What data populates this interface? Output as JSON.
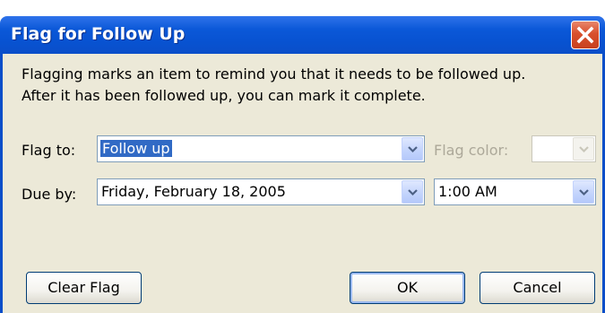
{
  "window": {
    "title": "Flag for Follow Up"
  },
  "description": {
    "line1": "Flagging marks an item to remind you that it needs to be followed up.",
    "line2": "After it has been followed up, you can mark it complete."
  },
  "flag_to": {
    "label": "Flag to:",
    "value": "Follow up"
  },
  "flag_color": {
    "label": "Flag color:",
    "value": ""
  },
  "due_by": {
    "label": "Due by:",
    "date_value": "Friday, February 18, 2005",
    "time_value": "1:00 AM"
  },
  "buttons": {
    "clear_flag": "Clear Flag",
    "ok": "OK",
    "cancel": "Cancel"
  },
  "icons": {
    "close": "close-icon",
    "dropdown": "chevron-down-icon"
  },
  "colors": {
    "titlebar": "#0853d2",
    "dialog_bg": "#ece9d8",
    "selection": "#316ac5",
    "close_button": "#d8502d"
  }
}
